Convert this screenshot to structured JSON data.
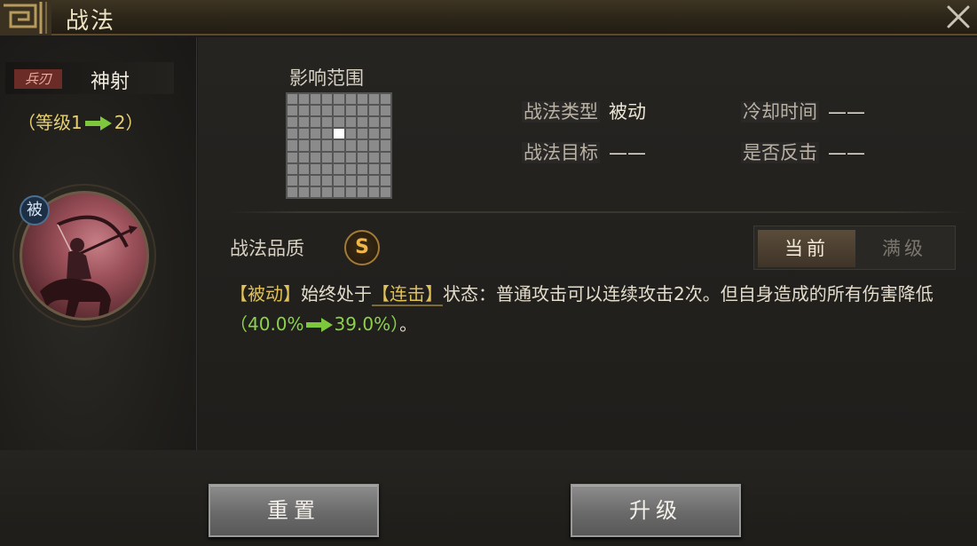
{
  "header": {
    "title": "战法"
  },
  "left": {
    "weapon_tag": "兵刃",
    "skill_name": "神射",
    "level_prefix": "（等级1",
    "level_suffix": "2）",
    "passive_badge": "被"
  },
  "main": {
    "range_label": "影响范围",
    "range_grid": {
      "rows": 9,
      "cols": 9,
      "highlight": [
        4,
        3
      ]
    },
    "info": {
      "type_label": "战法类型",
      "type_value": "被动",
      "cooldown_label": "冷却时间",
      "cooldown_value": "——",
      "target_label": "战法目标",
      "target_value": "——",
      "counter_label": "是否反击",
      "counter_value": "——"
    },
    "quality_label": "战法品质",
    "quality_value": "S",
    "toggle": {
      "current": "当前",
      "max": "满级"
    },
    "desc": {
      "tag1": "【被动】",
      "text1": "始终处于",
      "tag2": "【连击】",
      "text2": "状态：普通攻击可以连续攻击2次。但自身造成的所有伤害降低",
      "paren_open": "（",
      "from_value": "40.0%",
      "to_value": "39.0%",
      "paren_close": "）",
      "text3": "。"
    }
  },
  "buttons": {
    "reset": "重置",
    "upgrade": "升级"
  },
  "colors": {
    "accent_gold": "#e0c15a",
    "green": "#8bd24a",
    "quality_orange": "#f0b64a"
  }
}
